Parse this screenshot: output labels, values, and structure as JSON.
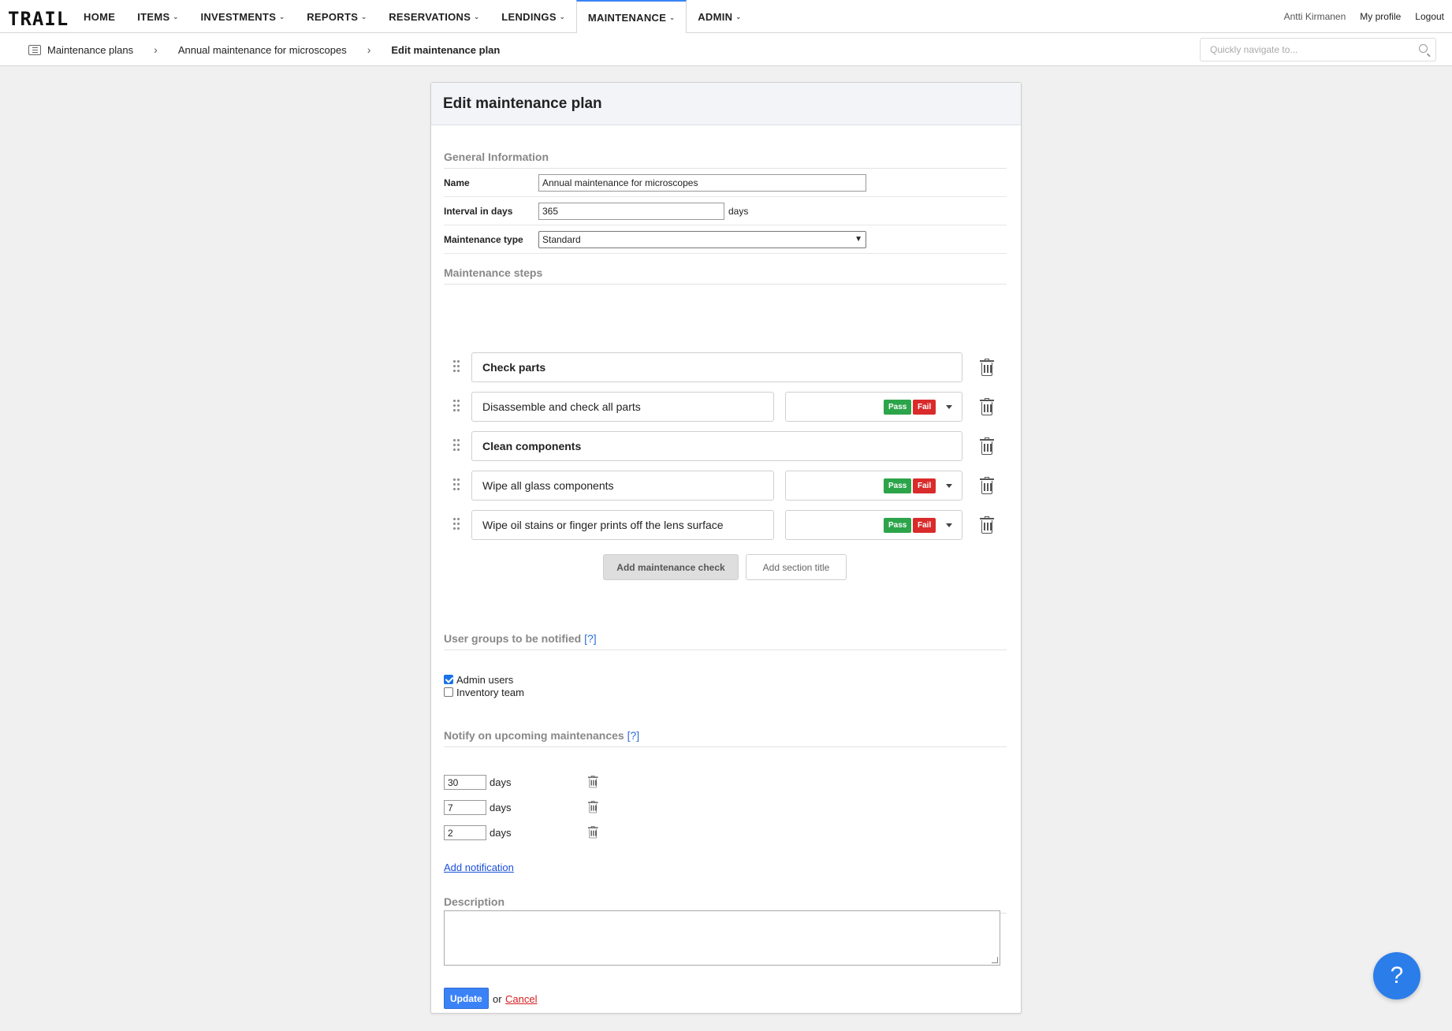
{
  "app": {
    "logo": "TRAIL"
  },
  "nav": {
    "items": [
      {
        "label": "HOME",
        "has_menu": false
      },
      {
        "label": "ITEMS",
        "has_menu": true
      },
      {
        "label": "INVESTMENTS",
        "has_menu": true
      },
      {
        "label": "REPORTS",
        "has_menu": true
      },
      {
        "label": "RESERVATIONS",
        "has_menu": true
      },
      {
        "label": "LENDINGS",
        "has_menu": true
      },
      {
        "label": "MAINTENANCE",
        "has_menu": true,
        "active": true
      },
      {
        "label": "ADMIN",
        "has_menu": true
      }
    ],
    "user": "Antti Kirmanen",
    "profile": "My profile",
    "logout": "Logout"
  },
  "breadcrumb": {
    "items": [
      "Maintenance plans",
      "Annual maintenance for microscopes",
      "Edit maintenance plan"
    ],
    "quicknav_placeholder": "Quickly navigate to..."
  },
  "form": {
    "title": "Edit maintenance plan",
    "general": {
      "title": "General Information",
      "name_label": "Name",
      "name_value": "Annual maintenance for microscopes",
      "interval_label": "Interval in days",
      "interval_value": "365",
      "interval_unit": "days",
      "type_label": "Maintenance type",
      "type_value": "Standard"
    },
    "steps": {
      "title": "Maintenance steps",
      "items": [
        {
          "text": "Check parts",
          "kind": "section"
        },
        {
          "text": "Disassemble and check all parts",
          "kind": "check"
        },
        {
          "text": "Clean components",
          "kind": "section"
        },
        {
          "text": "Wipe all glass components",
          "kind": "check"
        },
        {
          "text": "Wipe oil stains or finger prints off the lens surface",
          "kind": "check"
        }
      ],
      "pass_label": "Pass",
      "fail_label": "Fail",
      "add_check": "Add maintenance check",
      "add_section": "Add section title"
    },
    "groups": {
      "title": "User groups to be notified",
      "help": "[?]",
      "items": [
        {
          "label": "Admin users",
          "checked": true
        },
        {
          "label": "Inventory team",
          "checked": false
        }
      ]
    },
    "notify": {
      "title": "Notify on upcoming maintenances",
      "help": "[?]",
      "items": [
        {
          "value": "30",
          "unit": "days"
        },
        {
          "value": "7",
          "unit": "days"
        },
        {
          "value": "2",
          "unit": "days"
        }
      ],
      "add": "Add notification"
    },
    "description": {
      "title": "Description",
      "value": ""
    },
    "submit": "Update",
    "or": "or",
    "cancel": "Cancel"
  },
  "help_bubble": "?",
  "colors": {
    "pass": "#2ca44a",
    "fail": "#d92b2b",
    "accent": "#3b82f6",
    "link": "#1a4fd8",
    "cancel": "#d71d1d"
  }
}
